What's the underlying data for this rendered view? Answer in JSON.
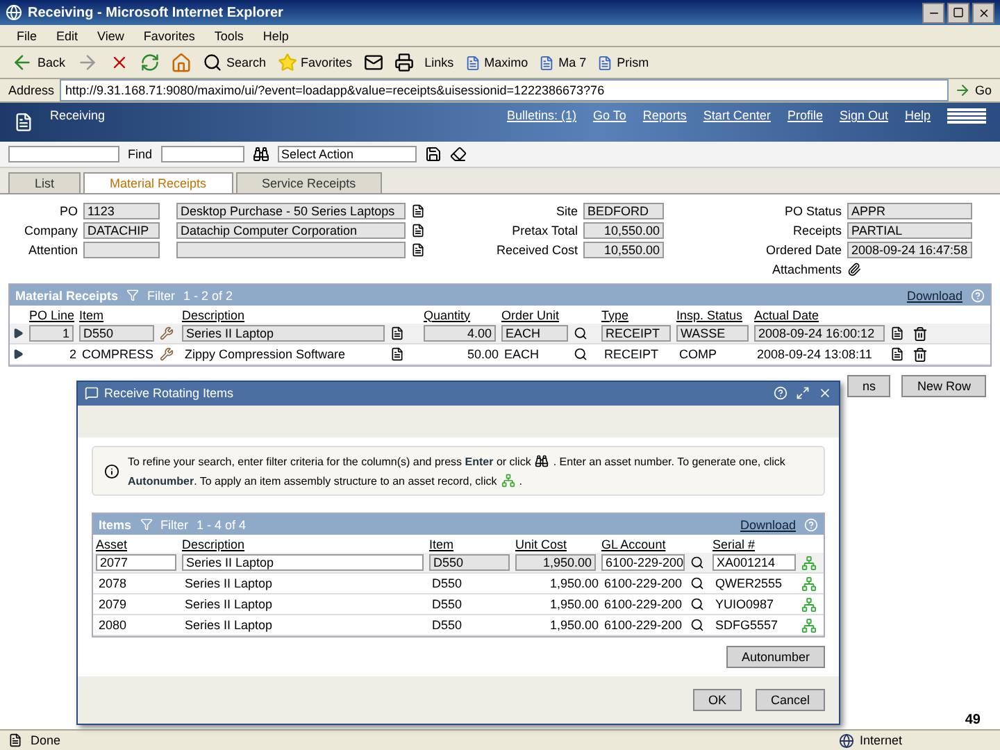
{
  "window": {
    "title": "Receiving - Microsoft Internet Explorer"
  },
  "menu": [
    "File",
    "Edit",
    "View",
    "Favorites",
    "Tools",
    "Help"
  ],
  "browser_toolbar": {
    "back": "Back",
    "search": "Search",
    "favorites": "Favorites",
    "links_label": "Links",
    "links": [
      "Maximo",
      "Ma 7",
      "Prism"
    ]
  },
  "address_bar": {
    "label": "Address",
    "url": "http://9.31.168.71:9080/maximo/ui/?event=loadapp&value=receipts&uisessionid=1222386673?76",
    "go": "Go"
  },
  "app_header": {
    "title": "Receiving",
    "links": [
      "Bulletins: (1)",
      "Go To",
      "Reports",
      "Start Center",
      "Profile",
      "Sign Out",
      "Help"
    ]
  },
  "app_toolbar": {
    "find_label": "Find",
    "action_placeholder": "Select Action"
  },
  "tabs": [
    {
      "label": "List",
      "selected": false
    },
    {
      "label": "Material Receipts",
      "selected": true
    },
    {
      "label": "Service Receipts",
      "selected": false
    }
  ],
  "form": {
    "left": [
      {
        "label": "PO",
        "value": "1123",
        "description": "Desktop Purchase - 50 Series Laptops"
      },
      {
        "label": "Company",
        "value": "DATACHIP",
        "description": "Datachip Computer Corporation"
      },
      {
        "label": "Attention"
      }
    ],
    "middle": [
      {
        "label": "Site",
        "value": "BEDFORD"
      },
      {
        "label": "Pretax Total",
        "value": "10,550.00"
      },
      {
        "label": "Received Cost",
        "value": "10,550.00"
      }
    ],
    "right": [
      {
        "label": "PO Status",
        "value": "APPR",
        "kind": "field"
      },
      {
        "label": "Receipts",
        "value": "PARTIAL",
        "kind": "field"
      },
      {
        "label": "Ordered Date",
        "value": "2008-09-24 16:47:58",
        "kind": "field"
      },
      {
        "label": "Attachments",
        "kind": "attachment"
      }
    ]
  },
  "receipts_table": {
    "title": "Material Receipts",
    "filter": "Filter",
    "paging": "1 - 2 of 2",
    "download": "Download",
    "columns": [
      "PO Line",
      "Item",
      "Description",
      "Quantity",
      "Order Unit",
      "Type",
      "Insp. Status",
      "Actual Date"
    ],
    "rows": [
      {
        "cells": [
          "1",
          "D550",
          "Series II Laptop",
          "4.00",
          "EACH",
          "RECEIPT",
          "WASSE",
          "2008-09-24 16:00:12"
        ],
        "editing": true
      },
      {
        "cells": [
          "2",
          "COMPRESS",
          "Zippy Compression Software",
          "50.00",
          "EACH",
          "RECEIPT",
          "COMP",
          "2008-09-24 13:08:11"
        ],
        "editing": false
      }
    ]
  },
  "page_buttons": [
    "ns",
    "New Row"
  ],
  "dialog": {
    "title": "Receive Rotating Items",
    "message": [
      "To refine your search, enter filter criteria for the column(s) and press **Enter** or click",
      ". Enter an asset number. To generate one, click",
      "**Autonumber**. To apply an item assembly structure to an asset record, click",
      "."
    ],
    "items_table": {
      "title": "Items",
      "filter": "Filter",
      "paging": "1 - 4 of 4",
      "download": "Download",
      "columns": [
        "Asset",
        "Description",
        "Item",
        "Unit Cost",
        "GL Account",
        "Serial #"
      ],
      "rows": [
        {
          "cells": [
            "2077",
            "Series II Laptop",
            "D550",
            "1,950.00",
            "6100-229-200",
            "XA001214"
          ],
          "editing": true
        },
        {
          "cells": [
            "2078",
            "Series II Laptop",
            "D550",
            "1,950.00",
            "6100-229-200",
            "QWER2555"
          ],
          "editing": false
        },
        {
          "cells": [
            "2079",
            "Series II Laptop",
            "D550",
            "1,950.00",
            "6100-229-200",
            "YUIO0987"
          ],
          "editing": false
        },
        {
          "cells": [
            "2080",
            "Series II Laptop",
            "D550",
            "1,950.00",
            "6100-229-200",
            "SDFG5557"
          ],
          "editing": false
        }
      ]
    },
    "autonumber": "Autonumber",
    "buttons": [
      "OK",
      "Cancel"
    ]
  },
  "status_bar": {
    "text": "Done",
    "zone": "Internet"
  },
  "page_number": "49"
}
